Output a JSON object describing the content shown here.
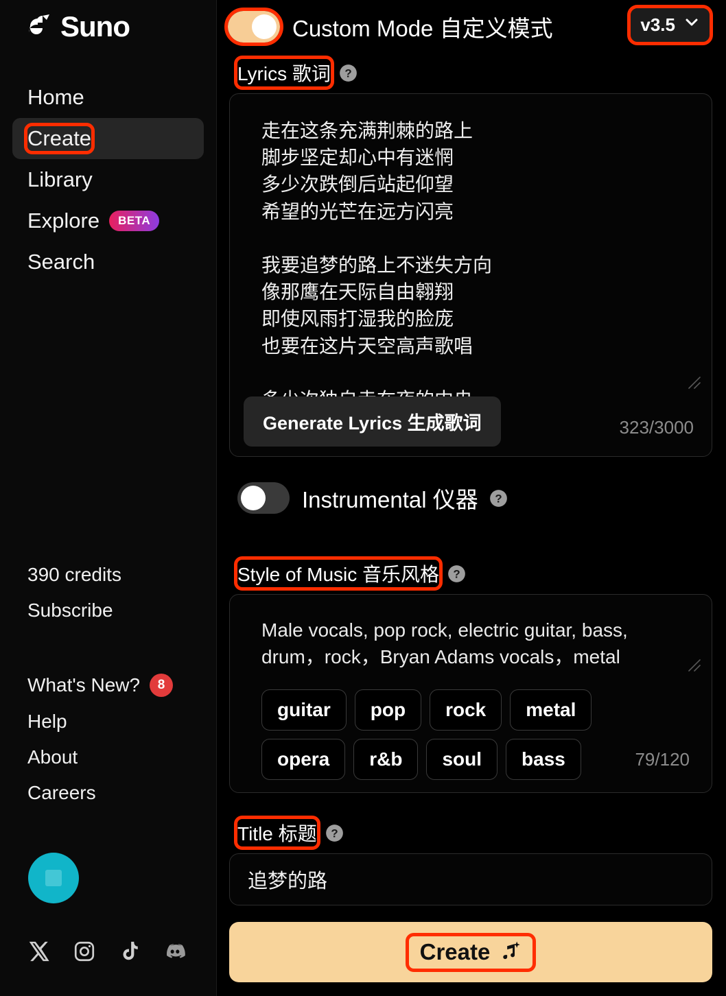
{
  "brand": {
    "name": "Suno",
    "logo_icon": "suno-wave-logo"
  },
  "sidebar": {
    "nav": [
      {
        "label": "Home",
        "name": "home",
        "active": false,
        "highlighted": false
      },
      {
        "label": "Create",
        "name": "create",
        "active": true,
        "highlighted": true
      },
      {
        "label": "Library",
        "name": "library",
        "active": false,
        "highlighted": false
      },
      {
        "label": "Explore",
        "name": "explore",
        "active": false,
        "badge": "BETA"
      },
      {
        "label": "Search",
        "name": "search",
        "active": false,
        "highlighted": false
      }
    ],
    "credits": "390 credits",
    "subscribe": "Subscribe",
    "links": [
      {
        "label": "What's New?",
        "badge": "8"
      },
      {
        "label": "Help",
        "badge": ""
      },
      {
        "label": "About",
        "badge": ""
      },
      {
        "label": "Careers",
        "badge": ""
      }
    ],
    "socials": [
      "x-icon",
      "instagram-icon",
      "tiktok-icon",
      "discord-icon"
    ],
    "avatar_color": "#11b5c9"
  },
  "header": {
    "custom_mode_label": "Custom Mode 自定义模式",
    "custom_mode_on": true,
    "version": "v3.5"
  },
  "lyrics": {
    "label": "Lyrics 歌词",
    "value": "走在这条充满荆棘的路上\n脚步坚定却心中有迷惘\n多少次跌倒后站起仰望\n希望的光芒在远方闪亮\n\n我要追梦的路上不迷失方向\n像那鹰在天际自由翱翔\n即使风雨打湿我的脸庞\n也要在这片天空高声歌唱\n\n多少次独自走在夜的中央",
    "generate_button": "Generate Lyrics 生成歌词",
    "counter": "323/3000"
  },
  "instrumental": {
    "label": "Instrumental 仪器",
    "on": false
  },
  "style": {
    "label": "Style of Music 音乐风格",
    "value": "Male vocals, pop rock, electric guitar, bass, drum，rock，Bryan Adams vocals，metal",
    "tags": [
      "guitar",
      "pop",
      "rock",
      "metal",
      "opera",
      "r&b",
      "soul",
      "bass"
    ],
    "counter": "79/120"
  },
  "title": {
    "label": "Title 标题",
    "value": "追梦的路"
  },
  "create": {
    "label": "Create",
    "icon": "music-note-sparkle-icon",
    "accent": "#f8d49b"
  },
  "annotations": {
    "highlight_color": "#ff2d00"
  }
}
